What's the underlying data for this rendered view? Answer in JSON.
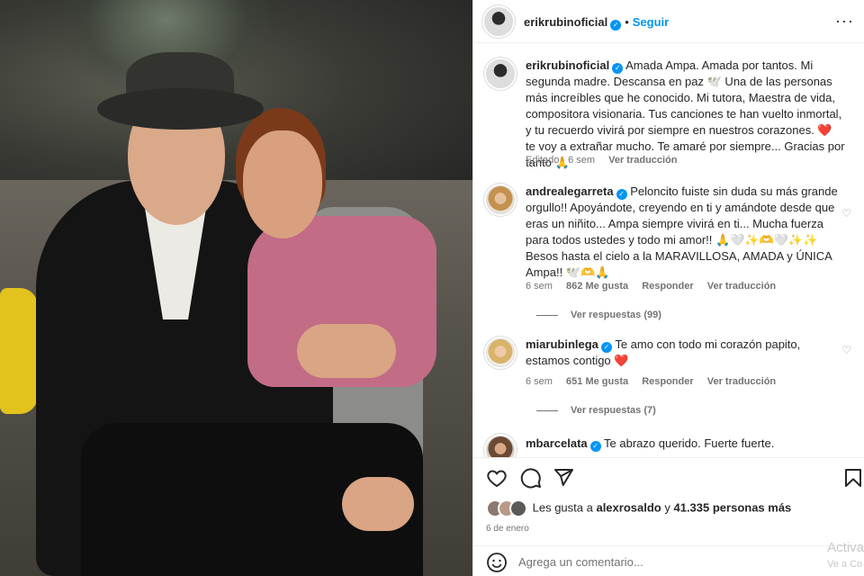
{
  "header": {
    "username": "erikrubinoficial",
    "follow_label": "Seguir",
    "more_label": "···"
  },
  "caption": {
    "username": "erikrubinoficial",
    "text": "Amada Ampa. Amada por tantos. Mi segunda madre. Descansa en paz 🕊️ Una de las personas más increíbles que he conocido. Mi tutora, Maestra de vida, compositora visionaria. Tus canciones te han vuelto inmortal, y tu recuerdo vivirá por siempre en nuestros corazones. ❤️ te voy a extrañar mucho. Te amaré por siempre... Gracias por tanto 🙏",
    "edited": "Editado · 6 sem",
    "translate": "Ver traducción"
  },
  "comments": [
    {
      "username": "andrealegarreta",
      "text": "Peloncito fuiste sin duda su más grande orgullo!! Apoyándote, creyendo en ti y amándote desde que eras un niñito... Ampa siempre vivirá en ti... Mucha fuerza para todos ustedes y todo mi amor!! 🙏🤍✨🫶🤍✨✨ Besos hasta el cielo a la MARAVILLOSA, AMADA y ÚNICA Ampa!! 🕊️🫶🙏",
      "time": "6 sem",
      "likes": "862 Me gusta",
      "reply": "Responder",
      "translate": "Ver traducción",
      "view_replies": "Ver respuestas (99)"
    },
    {
      "username": "miarubinlega",
      "text": "Te amo con todo mi corazón papito, estamos contigo ❤️",
      "time": "6 sem",
      "likes": "651 Me gusta",
      "reply": "Responder",
      "translate": "Ver traducción",
      "view_replies": "Ver respuestas (7)"
    },
    {
      "username": "mbarcelata",
      "text": "Te abrazo querido. Fuerte fuerte."
    }
  ],
  "likes_line": {
    "prefix": "Les gusta a",
    "user": "alexrosaldo",
    "middle": "y",
    "count": "41.335 personas más"
  },
  "post_date": "6 de enero",
  "add_comment": {
    "placeholder": "Agrega un comentario..."
  },
  "watermark": {
    "line1": "Activa",
    "line2": "Ve a Co"
  },
  "colors": {
    "accent": "#0095f6",
    "heart": "#ed4956",
    "muted": "#737373"
  }
}
